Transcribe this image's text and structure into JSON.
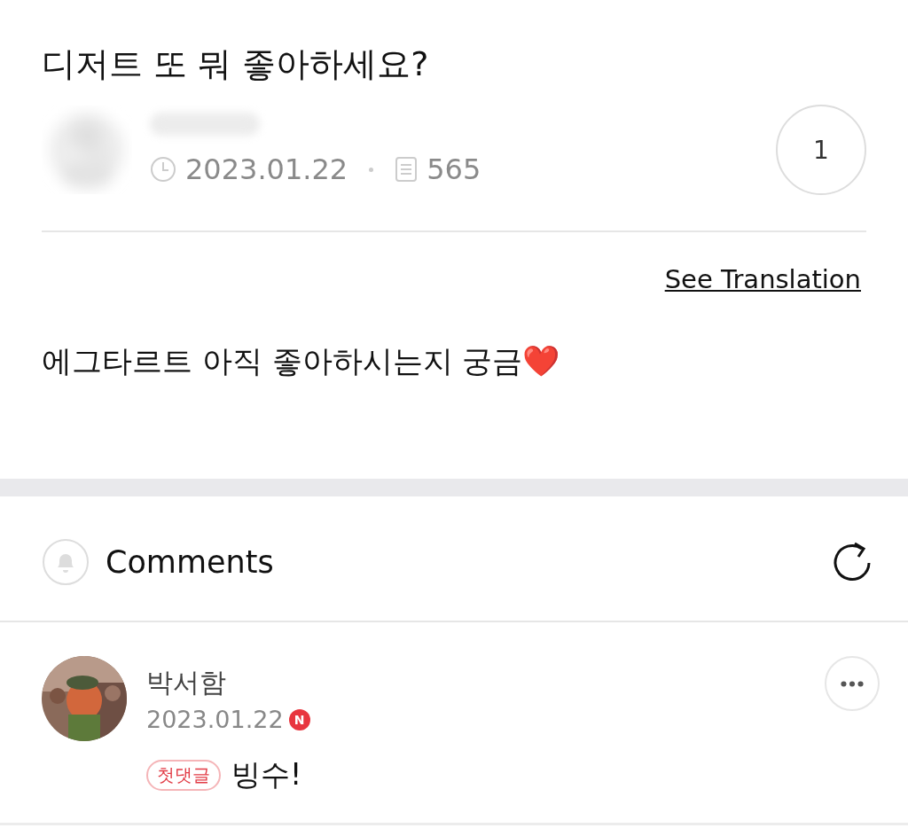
{
  "post": {
    "title": "디저트 또 뭐 좋아하세요?",
    "date": "2023.01.22",
    "views": "565",
    "like_count": "1",
    "translate_link": "See Translation",
    "body": "에그타르트 아직 좋아하시는지 궁금❤️"
  },
  "comments_header": {
    "title": "Comments"
  },
  "comments": [
    {
      "author": "박서함",
      "date": "2023.01.22",
      "new_mark": "N",
      "is_new": true,
      "badge": "첫댓글",
      "text": "빙수!"
    }
  ]
}
